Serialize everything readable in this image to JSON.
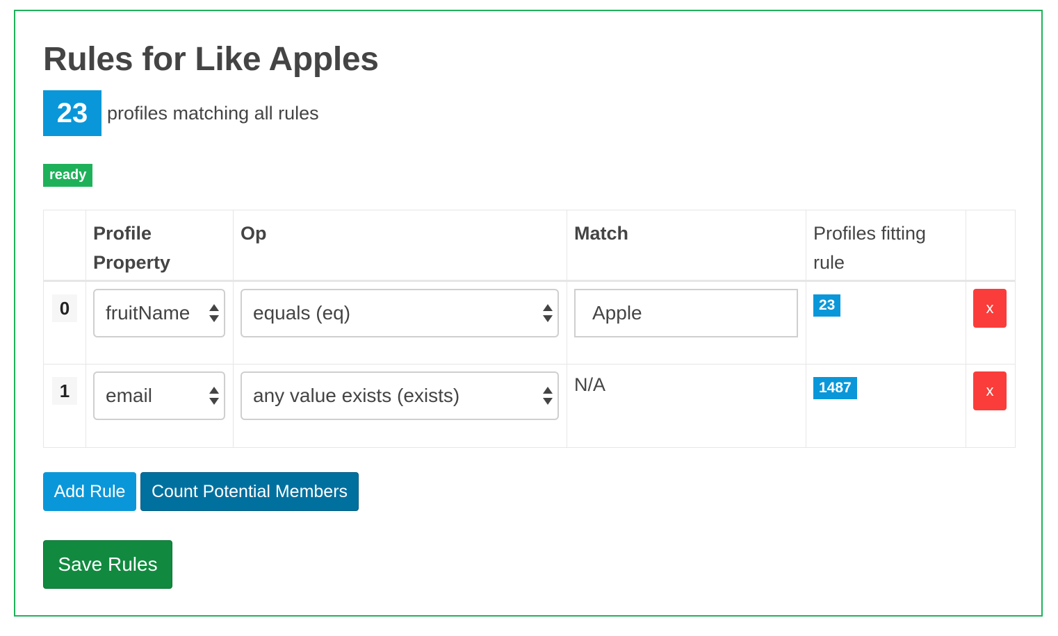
{
  "page": {
    "title": "Rules for Like Apples",
    "match_count": "23",
    "match_count_text": "profiles matching all rules",
    "status": "ready"
  },
  "table": {
    "headers": {
      "index": "",
      "property": "Profile Property",
      "op": "Op",
      "match": "Match",
      "fitting": "Profiles fitting rule",
      "actions": ""
    },
    "rows": [
      {
        "index": "0",
        "property": "fruitName",
        "op": "equals (eq)",
        "match": "Apple",
        "fitting": "23",
        "delete_label": "x"
      },
      {
        "index": "1",
        "property": "email",
        "op": "any value exists (exists)",
        "match": "N/A",
        "fitting": "1487",
        "delete_label": "x"
      }
    ]
  },
  "buttons": {
    "add_rule": "Add Rule",
    "count_members": "Count Potential Members",
    "save_rules": "Save Rules"
  },
  "colors": {
    "frame_border": "#1fb15a",
    "primary": "#0a97d9",
    "primary_dark": "#00709f",
    "success": "#118a3f",
    "danger": "#fa3d3a",
    "ready_badge": "#1fb15a"
  }
}
